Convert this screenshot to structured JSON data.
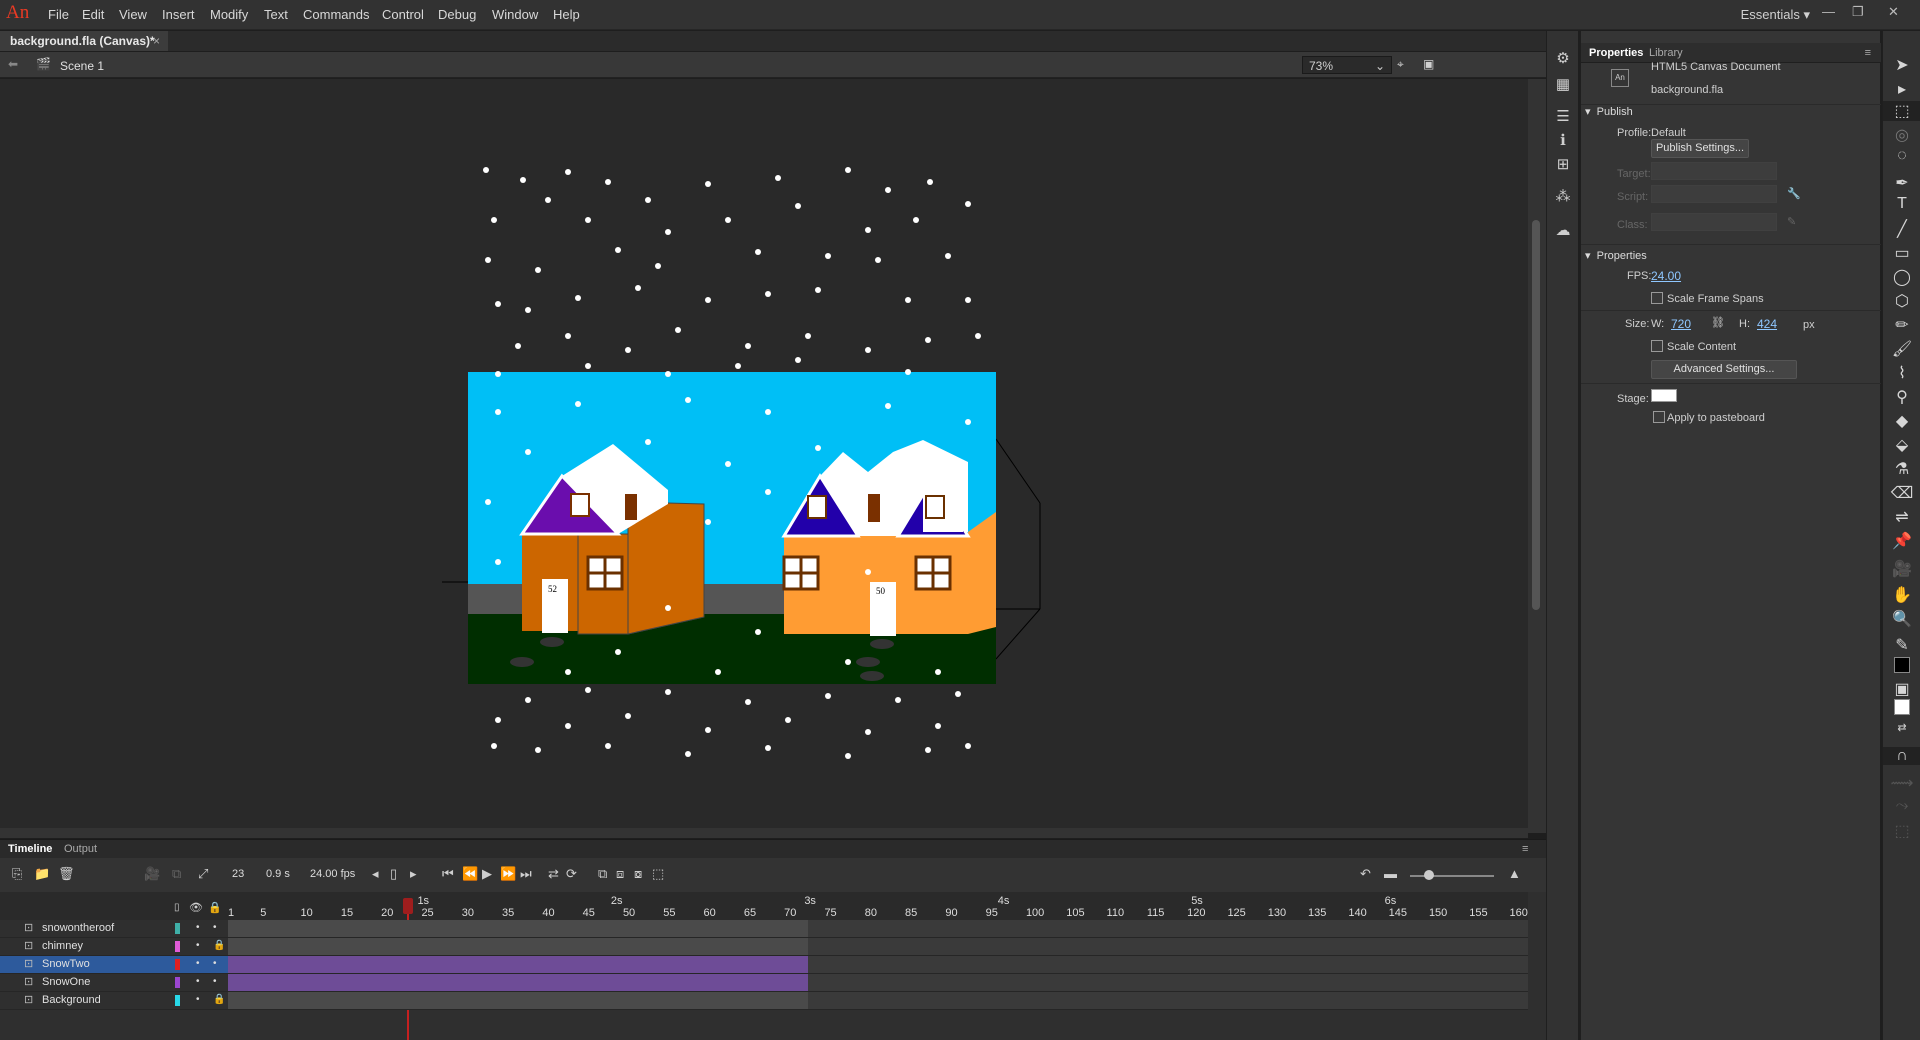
{
  "app": {
    "logo": "An",
    "workspace": "Essentials"
  },
  "menu": [
    "File",
    "Edit",
    "View",
    "Insert",
    "Modify",
    "Text",
    "Commands",
    "Control",
    "Debug",
    "Window",
    "Help"
  ],
  "document": {
    "tab_title": "background.fla (Canvas)*",
    "scene": "Scene 1",
    "zoom": "73%"
  },
  "stage": {
    "house_left_number": "52",
    "house_right_number": "50",
    "background": "#00bff6",
    "ground": "#002e00"
  },
  "properties": {
    "tabs": [
      "Properties",
      "Library"
    ],
    "doc_type": "HTML5 Canvas Document",
    "file_name": "background.fla",
    "publish_header": "Publish",
    "profile_label": "Profile:",
    "profile_value": "Default",
    "publish_settings": "Publish Settings...",
    "target_label": "Target:",
    "script_label": "Script:",
    "class_label": "Class:",
    "properties_header": "Properties",
    "fps_label": "FPS:",
    "fps_value": "24.00",
    "scale_frame_spans": "Scale Frame Spans",
    "size_label": "Size:",
    "w_label": "W:",
    "w_value": "720",
    "h_label": "H:",
    "h_value": "424",
    "px": "px",
    "scale_content": "Scale Content",
    "advanced_settings": "Advanced Settings...",
    "stage_label": "Stage:",
    "stage_color": "#ffffff",
    "apply_pasteboard": "Apply to pasteboard"
  },
  "timeline": {
    "tabs": [
      "Timeline",
      "Output"
    ],
    "current_frame": "23",
    "time": "0.9 s",
    "fps": "24.00 fps",
    "seconds": [
      "1s",
      "2s",
      "3s",
      "4s",
      "5s",
      "6s"
    ],
    "ticks": [
      "1",
      "5",
      "10",
      "15",
      "20",
      "25",
      "30",
      "35",
      "40",
      "45",
      "50",
      "55",
      "60",
      "65",
      "70",
      "75",
      "80",
      "85",
      "90",
      "95",
      "100",
      "105",
      "110",
      "115",
      "120",
      "125",
      "130",
      "135",
      "140",
      "145",
      "150",
      "155",
      "160"
    ],
    "layers": [
      {
        "name": "snowontheroof",
        "color": "#3fb0a8",
        "locked": false,
        "selected": false
      },
      {
        "name": "chimney",
        "color": "#e05bd6",
        "locked": true,
        "selected": false
      },
      {
        "name": "SnowTwo",
        "color": "#e02020",
        "locked": false,
        "selected": true
      },
      {
        "name": "SnowOne",
        "color": "#9b46d0",
        "locked": false,
        "selected": false
      },
      {
        "name": "Background",
        "color": "#28d8e8",
        "locked": true,
        "selected": false
      }
    ]
  }
}
